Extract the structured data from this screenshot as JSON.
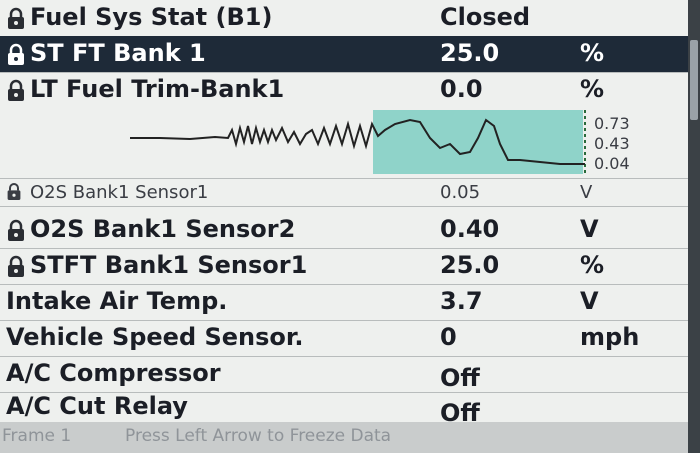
{
  "rows_top": [
    {
      "name": "Fuel Sys Stat (B1)",
      "value": "Closed",
      "unit": "",
      "locked": true,
      "selected": false
    },
    {
      "name": "ST FT Bank 1",
      "value": "25.0",
      "unit": "%",
      "locked": true,
      "selected": true
    },
    {
      "name": "LT Fuel Trim-Bank1",
      "value": "0.0",
      "unit": "%",
      "locked": true,
      "selected": false
    }
  ],
  "graph": {
    "scale_max": "0.73",
    "scale_mid": "0.43",
    "scale_min": "0.04",
    "highlight_color": "#8fd3c9"
  },
  "graph_row": {
    "name": "O2S Bank1 Sensor1",
    "value": "0.05",
    "unit": "V"
  },
  "rows_bottom": [
    {
      "name": "O2S Bank1 Sensor2",
      "value": "0.40",
      "unit": "V",
      "locked": true
    },
    {
      "name": "STFT Bank1 Sensor1",
      "value": "25.0",
      "unit": "%",
      "locked": true
    },
    {
      "name": "Intake Air Temp.",
      "value": "3.7",
      "unit": "V",
      "locked": false
    },
    {
      "name": "Vehicle Speed Sensor.",
      "value": "0",
      "unit": "mph",
      "locked": false
    },
    {
      "name": "A/C Compressor",
      "value": "Off",
      "unit": "",
      "locked": false
    },
    {
      "name": "A/C Cut Relay",
      "value": "Off",
      "unit": "",
      "locked": false
    }
  ],
  "footer": {
    "frame": "Frame 1",
    "hint": "Press Left Arrow to Freeze Data"
  },
  "icons": {
    "lock": "lock-icon"
  }
}
